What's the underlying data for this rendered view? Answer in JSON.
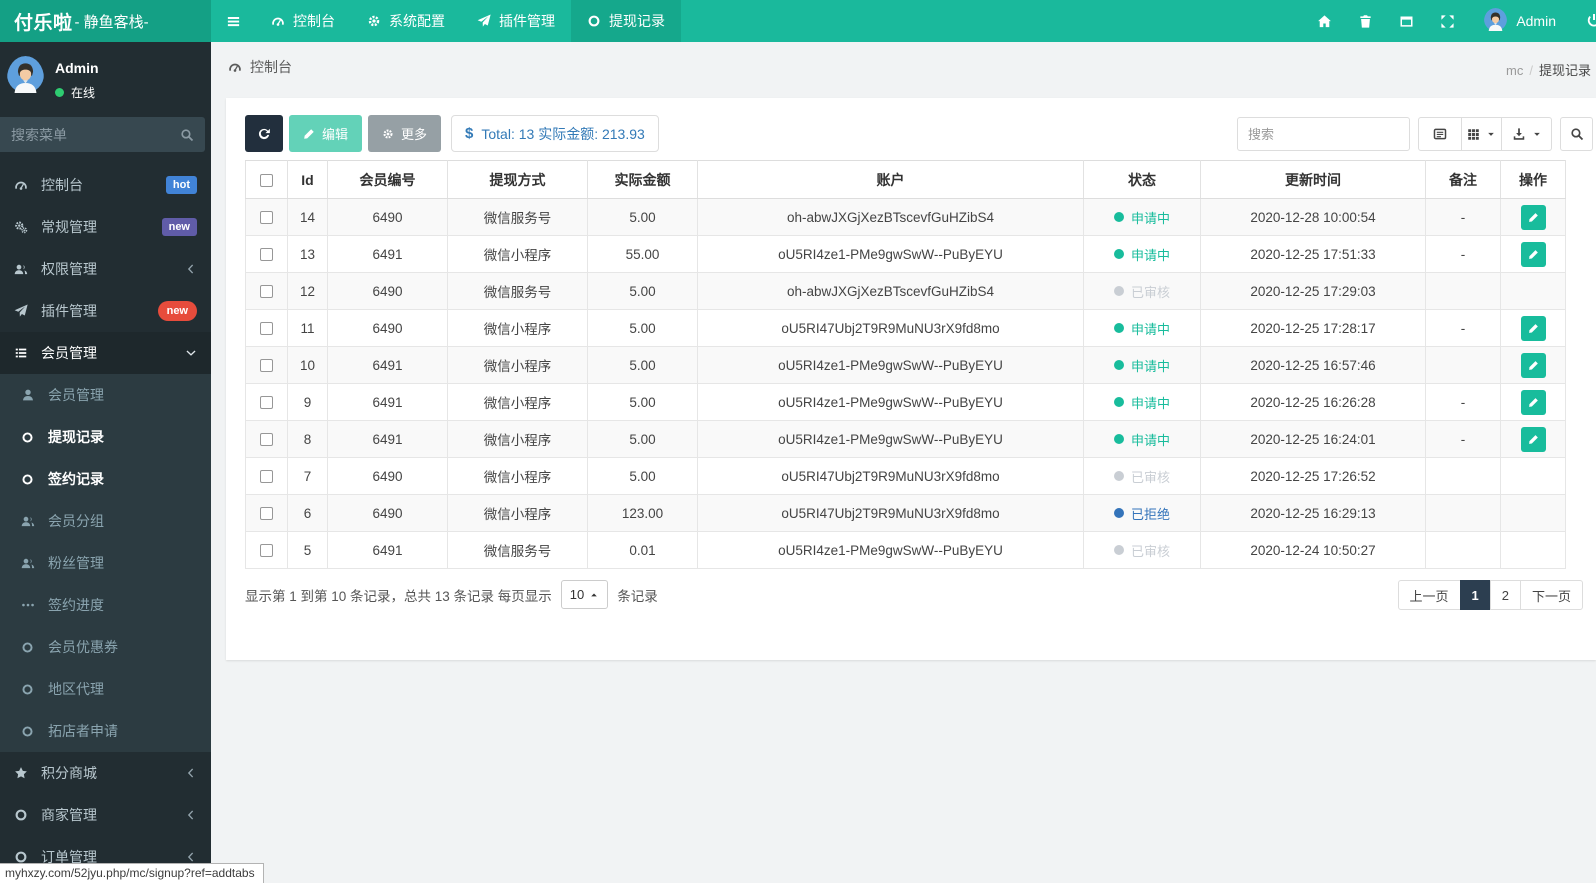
{
  "colors": {
    "navbar": "#1ab99c",
    "brand_bg": "#14a085",
    "sidebar": "#222d32",
    "status_applying": "#18bc9c",
    "status_reviewed": "#c9ced4",
    "status_rejected": "#3474ba",
    "pager_active": "#2c3e50"
  },
  "navbar": {
    "brand_bold": "付乐啦",
    "brand_rest": "- 静鱼客栈-",
    "menu": [
      {
        "label": "控制台",
        "icon": "dashboard-icon",
        "active": false
      },
      {
        "label": "系统配置",
        "icon": "gear-icon",
        "active": false
      },
      {
        "label": "插件管理",
        "icon": "paper-plane-icon",
        "active": false
      },
      {
        "label": "提现记录",
        "icon": "circle-icon",
        "active": true
      }
    ],
    "right_icons": [
      {
        "name": "home-icon"
      },
      {
        "name": "trash-icon"
      },
      {
        "name": "clear-cache-icon"
      },
      {
        "name": "fullscreen-icon"
      }
    ],
    "username": "Admin"
  },
  "sidebar": {
    "username": "Admin",
    "status": "在线",
    "search_placeholder": "搜索菜单",
    "menu": [
      {
        "label": "控制台",
        "icon": "dashboard-icon",
        "badge": "hot",
        "badge_style": "blue"
      },
      {
        "label": "常规管理",
        "icon": "gears-icon",
        "badge": "new",
        "badge_style": "purple"
      },
      {
        "label": "权限管理",
        "icon": "users-icon",
        "arrow": "left"
      },
      {
        "label": "插件管理",
        "icon": "paper-plane-icon",
        "badge": "new",
        "badge_style": "red-pill"
      },
      {
        "label": "会员管理",
        "icon": "list-icon",
        "arrow": "down",
        "active": true,
        "children": [
          {
            "label": "会员管理",
            "icon": "user-icon",
            "highlight": false
          },
          {
            "label": "提现记录",
            "icon": "circle-icon",
            "highlight": true
          },
          {
            "label": "签约记录",
            "icon": "circle-icon",
            "highlight": true
          },
          {
            "label": "会员分组",
            "icon": "users-icon",
            "highlight": false
          },
          {
            "label": "粉丝管理",
            "icon": "users-icon",
            "highlight": false
          },
          {
            "label": "签约进度",
            "icon": "ellipsis-icon",
            "highlight": false
          },
          {
            "label": "会员优惠券",
            "icon": "circle-icon",
            "highlight": false
          },
          {
            "label": "地区代理",
            "icon": "circle-icon",
            "highlight": false
          },
          {
            "label": "拓店者申请",
            "icon": "circle-icon",
            "highlight": false
          }
        ]
      },
      {
        "label": "积分商城",
        "icon": "star-icon",
        "arrow": "left"
      },
      {
        "label": "商家管理",
        "icon": "circle-icon",
        "arrow": "left"
      },
      {
        "label": "订单管理",
        "icon": "circle-icon",
        "arrow": "left"
      }
    ]
  },
  "breadcrumb": {
    "page": "控制台",
    "parent": "mc",
    "current": "提现记录"
  },
  "toolbar": {
    "edit_label": "编辑",
    "more_label": "更多",
    "total_prefix": "$",
    "total_text": "Total: 13 实际金额: 213.93",
    "search_placeholder": "搜索"
  },
  "table": {
    "headers": [
      "Id",
      "会员编号",
      "提现方式",
      "实际金额",
      "账户",
      "状态",
      "更新时间",
      "备注",
      "操作"
    ],
    "rows": [
      {
        "id": "14",
        "member_no": "6490",
        "method": "微信服务号",
        "amount": "5.00",
        "account": "oh-abwJXGjXezBTscevfGuHZibS4",
        "status": "申请中",
        "status_type": "applying",
        "updated": "2020-12-28 10:00:54",
        "remark": "-",
        "can_edit": true
      },
      {
        "id": "13",
        "member_no": "6491",
        "method": "微信小程序",
        "amount": "55.00",
        "account": "oU5RI4ze1-PMe9gwSwW--PuByEYU",
        "status": "申请中",
        "status_type": "applying",
        "updated": "2020-12-25 17:51:33",
        "remark": "-",
        "can_edit": true
      },
      {
        "id": "12",
        "member_no": "6490",
        "method": "微信服务号",
        "amount": "5.00",
        "account": "oh-abwJXGjXezBTscevfGuHZibS4",
        "status": "已审核",
        "status_type": "reviewed",
        "updated": "2020-12-25 17:29:03",
        "remark": "",
        "can_edit": false
      },
      {
        "id": "11",
        "member_no": "6490",
        "method": "微信小程序",
        "amount": "5.00",
        "account": "oU5RI47Ubj2T9R9MuNU3rX9fd8mo",
        "status": "申请中",
        "status_type": "applying",
        "updated": "2020-12-25 17:28:17",
        "remark": "-",
        "can_edit": true
      },
      {
        "id": "10",
        "member_no": "6491",
        "method": "微信小程序",
        "amount": "5.00",
        "account": "oU5RI4ze1-PMe9gwSwW--PuByEYU",
        "status": "申请中",
        "status_type": "applying",
        "updated": "2020-12-25 16:57:46",
        "remark": "",
        "can_edit": true
      },
      {
        "id": "9",
        "member_no": "6491",
        "method": "微信小程序",
        "amount": "5.00",
        "account": "oU5RI4ze1-PMe9gwSwW--PuByEYU",
        "status": "申请中",
        "status_type": "applying",
        "updated": "2020-12-25 16:26:28",
        "remark": "-",
        "can_edit": true
      },
      {
        "id": "8",
        "member_no": "6491",
        "method": "微信小程序",
        "amount": "5.00",
        "account": "oU5RI4ze1-PMe9gwSwW--PuByEYU",
        "status": "申请中",
        "status_type": "applying",
        "updated": "2020-12-25 16:24:01",
        "remark": "-",
        "can_edit": true
      },
      {
        "id": "7",
        "member_no": "6490",
        "method": "微信小程序",
        "amount": "5.00",
        "account": "oU5RI47Ubj2T9R9MuNU3rX9fd8mo",
        "status": "已审核",
        "status_type": "reviewed",
        "updated": "2020-12-25 17:26:52",
        "remark": "",
        "can_edit": false
      },
      {
        "id": "6",
        "member_no": "6490",
        "method": "微信小程序",
        "amount": "123.00",
        "account": "oU5RI47Ubj2T9R9MuNU3rX9fd8mo",
        "status": "已拒绝",
        "status_type": "rejected",
        "updated": "2020-12-25 16:29:13",
        "remark": "",
        "can_edit": false
      },
      {
        "id": "5",
        "member_no": "6491",
        "method": "微信服务号",
        "amount": "0.01",
        "account": "oU5RI4ze1-PMe9gwSwW--PuByEYU",
        "status": "已审核",
        "status_type": "reviewed",
        "updated": "2020-12-24 10:50:27",
        "remark": "",
        "can_edit": false
      }
    ]
  },
  "pagination": {
    "info_prefix": "显示第 1 到第 10 条记录，总共 13 条记录 每页显示",
    "page_size": "10",
    "info_suffix": "条记录",
    "prev_label": "上一页",
    "pages": [
      "1",
      "2"
    ],
    "active_page": "1",
    "next_label": "下一页"
  },
  "statusbar": {
    "url": "myhxzy.com/52jyu.php/mc/signup?ref=addtabs"
  }
}
